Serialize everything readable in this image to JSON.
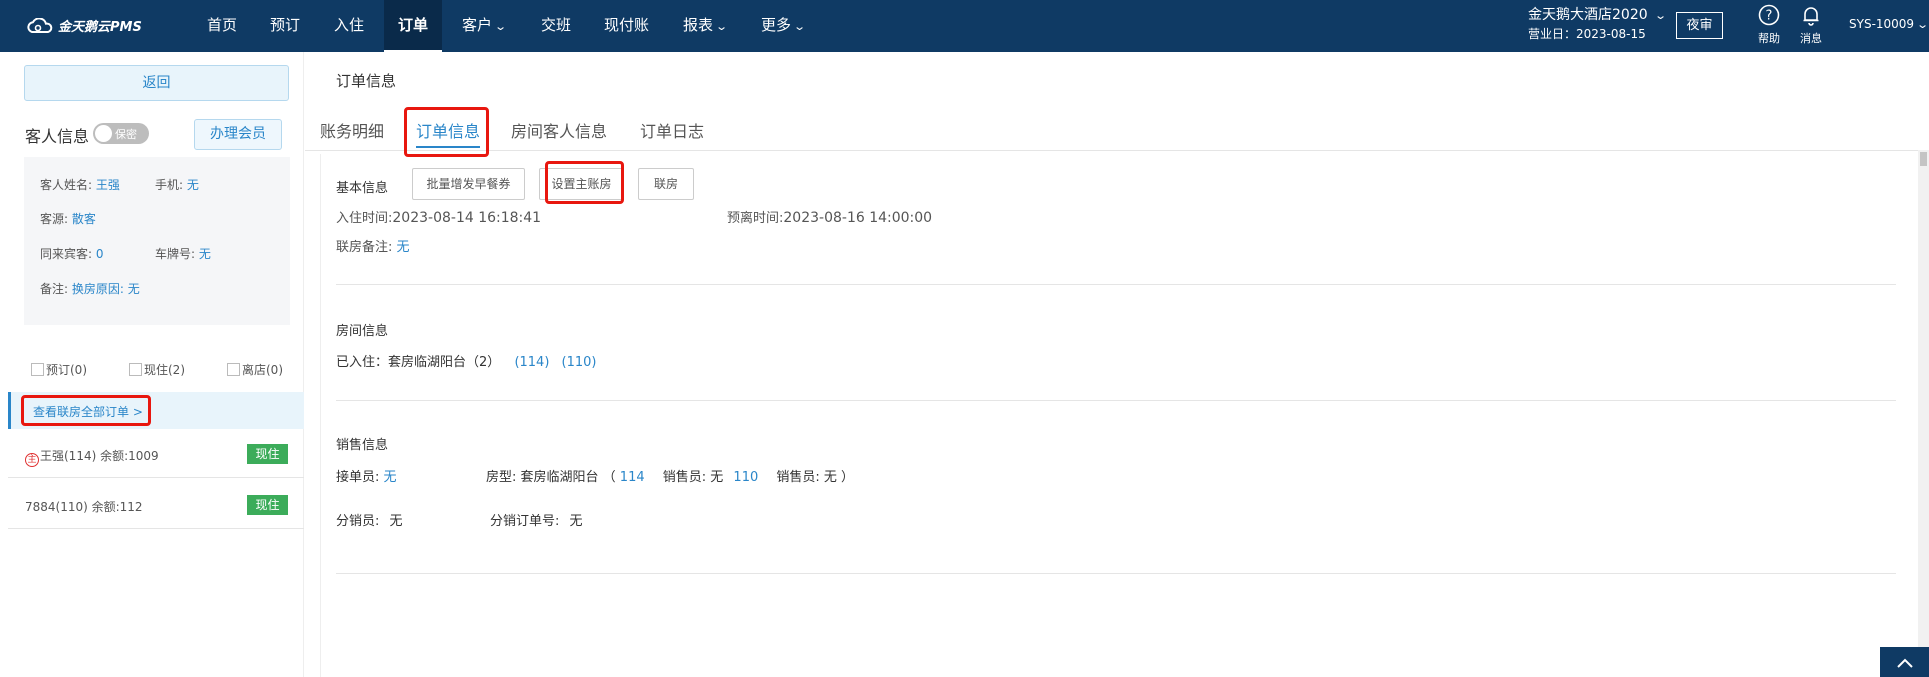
{
  "app": {
    "logo_text": "金天鹅云PMS"
  },
  "nav": [
    {
      "label": "首页"
    },
    {
      "label": "预订"
    },
    {
      "label": "入住"
    },
    {
      "label": "订单"
    },
    {
      "label": "客户"
    },
    {
      "label": "交班"
    },
    {
      "label": "现付账"
    },
    {
      "label": "报表"
    },
    {
      "label": "更多"
    }
  ],
  "header": {
    "hotel": "金天鹅大酒店2020",
    "biz_date": "营业日：2023-08-15",
    "night_audit": "夜审",
    "help": "帮助",
    "messages": "消息",
    "user": "SYS-10009"
  },
  "left": {
    "back": "返回",
    "guest_title": "客人信息",
    "privacy_toggle": "保密",
    "member_btn": "办理会员",
    "guest": {
      "name_label": "客人姓名:",
      "name": "王强",
      "phone_label": "手机:",
      "phone": "无",
      "source_label": "客源:",
      "source": "散客",
      "companions_label": "同来宾客:",
      "companions": "0",
      "plate_label": "车牌号:",
      "plate": "无",
      "note_label": "备注:",
      "note": "换房原因: 无"
    },
    "filters": [
      {
        "label": "预订(0)"
      },
      {
        "label": "现住(2)"
      },
      {
        "label": "离店(0)"
      }
    ],
    "view_all": "查看联房全部订单 >",
    "orders": [
      {
        "master_icon": "主",
        "text": "王强(114)   余额:1009",
        "status": "现住"
      },
      {
        "text": "7884(110)   余额:112",
        "status": "现住"
      }
    ]
  },
  "main": {
    "page_title": "订单信息",
    "tabs": [
      {
        "label": "账务明细"
      },
      {
        "label": "订单信息"
      },
      {
        "label": "房间客人信息"
      },
      {
        "label": "订单日志"
      }
    ],
    "basic": {
      "title": "基本信息",
      "btn_breakfast": "批量增发早餐券",
      "btn_master": "设置主账房",
      "btn_link": "联房",
      "checkin_label": "入住时间:",
      "checkin": "2023-08-14 16:18:41",
      "checkout_label": "预离时间:",
      "checkout": "2023-08-16 14:00:00",
      "link_note_label": "联房备注:",
      "link_note": "无"
    },
    "room": {
      "title": "房间信息",
      "checked_label": "已入住：",
      "room_type": "套房临湖阳台（2）",
      "rooms": [
        "(114)",
        "(110)"
      ]
    },
    "sales": {
      "title": "销售信息",
      "receiver_label": "接单员:",
      "receiver": "无",
      "roomtype_label": "房型: 套房临湖阳台 （",
      "room1": "114",
      "seller1_label": "销售员: 无",
      "room2": "110",
      "seller2_label": "销售员:  无   ）",
      "distributor_label": "分销员:",
      "distributor": "无",
      "dist_order_label": "分销订单号:",
      "dist_order": "无"
    }
  },
  "colors": {
    "nav_bg": "#0f3a64",
    "accent": "#2a86c9",
    "highlight_box": "#e8170f",
    "status_green": "#3cac5a"
  }
}
